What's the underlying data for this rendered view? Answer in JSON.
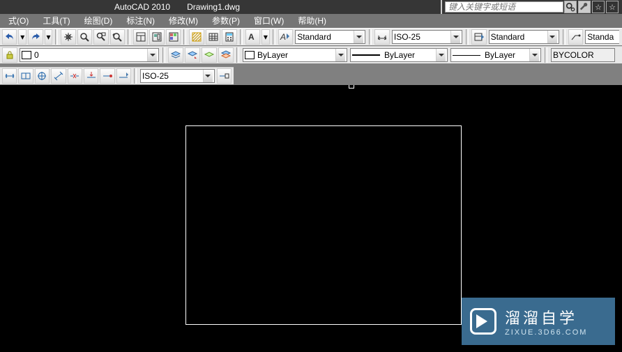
{
  "title": {
    "app": "AutoCAD 2010",
    "file": "Drawing1.dwg"
  },
  "search": {
    "placeholder": "键入关键字或短语"
  },
  "menus": [
    "式(O)",
    "工具(T)",
    "绘图(D)",
    "标注(N)",
    "修改(M)",
    "参数(P)",
    "窗口(W)",
    "帮助(H)"
  ],
  "style_combos": {
    "text_style": "Standard",
    "dim_style": "ISO-25",
    "table_style": "Standard",
    "mleader_style": "Standa"
  },
  "layer_row": {
    "layer": "0",
    "color": "ByLayer",
    "linetype": "ByLayer",
    "lineweight": "ByLayer",
    "plotstyle": "BYCOLOR"
  },
  "dim_row": {
    "current_dim_style": "ISO-25"
  },
  "watermark": {
    "brand": "溜溜自学",
    "url": "ZIXUE.3D66.COM"
  }
}
